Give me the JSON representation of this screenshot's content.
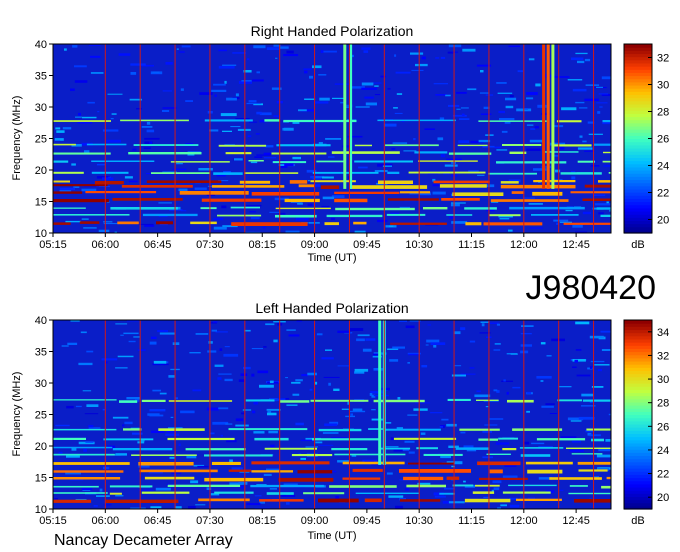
{
  "figure": {
    "observation_id": "J980420",
    "instrument": "Nancay Decameter Array"
  },
  "colormap": [
    "#00008f",
    "#0000ff",
    "#0060ff",
    "#00c0ff",
    "#40ffc0",
    "#c0ff40",
    "#ffc000",
    "#ff4000",
    "#8f0000"
  ],
  "chart_data": [
    {
      "type": "heatmap",
      "title": "Right Handed Polarization",
      "xlabel": "Time (UT)",
      "ylabel": "Frequency (MHz)",
      "x_ticks": [
        "05:15",
        "06:00",
        "06:45",
        "07:30",
        "08:15",
        "09:00",
        "09:45",
        "10:30",
        "11:15",
        "12:00",
        "12:45"
      ],
      "x_range_minutes": [
        315,
        795
      ],
      "y_ticks": [
        10,
        15,
        20,
        25,
        30,
        35,
        40
      ],
      "ylim": [
        10,
        40
      ],
      "colorbar": {
        "label": "dB",
        "ticks": [
          20,
          22,
          24,
          26,
          28,
          30,
          32
        ],
        "range": [
          19,
          33
        ]
      },
      "grid": "vertical lines every 30 min",
      "features": {
        "strong_bands_MHz": [
          11.5,
          15.2,
          16.3,
          17.4,
          18.1
        ],
        "medium_bands_MHz": [
          12.8,
          13.9,
          19.5,
          21.3,
          22.7,
          23.9,
          27.8
        ],
        "vertical_bursts": [
          {
            "time_min": 566,
            "f_from": 17,
            "f_to": 40,
            "level": 0.55
          },
          {
            "time_min": 571,
            "f_from": 17,
            "f_to": 40,
            "level": 0.5
          },
          {
            "time_min": 737,
            "f_from": 17,
            "f_to": 40,
            "level": 0.9
          },
          {
            "time_min": 741,
            "f_from": 17,
            "f_to": 40,
            "level": 0.85
          },
          {
            "time_min": 745,
            "f_from": 17,
            "f_to": 40,
            "level": 0.6
          }
        ]
      }
    },
    {
      "type": "heatmap",
      "title": "Left Handed Polarization",
      "xlabel": "Time (UT)",
      "ylabel": "Frequency (MHz)",
      "x_ticks": [
        "05:15",
        "06:00",
        "06:45",
        "07:30",
        "08:15",
        "09:00",
        "09:45",
        "10:30",
        "11:15",
        "12:00",
        "12:45"
      ],
      "x_range_minutes": [
        315,
        795
      ],
      "y_ticks": [
        10,
        15,
        20,
        25,
        30,
        35,
        40
      ],
      "ylim": [
        10,
        40
      ],
      "colorbar": {
        "label": "dB",
        "ticks": [
          20,
          22,
          24,
          26,
          28,
          30,
          32,
          34
        ],
        "range": [
          19,
          35
        ]
      },
      "grid": "vertical lines every 30 min",
      "features": {
        "strong_bands_MHz": [
          11.3,
          14.8,
          16.0,
          17.2
        ],
        "medium_bands_MHz": [
          12.5,
          13.6,
          18.6,
          19.6,
          21.1,
          22.6,
          27.2
        ],
        "vertical_bursts": [
          {
            "time_min": 596,
            "f_from": 17,
            "f_to": 40,
            "level": 0.5
          },
          {
            "time_min": 600,
            "f_from": 17,
            "f_to": 40,
            "level": 0.45
          }
        ]
      }
    }
  ]
}
